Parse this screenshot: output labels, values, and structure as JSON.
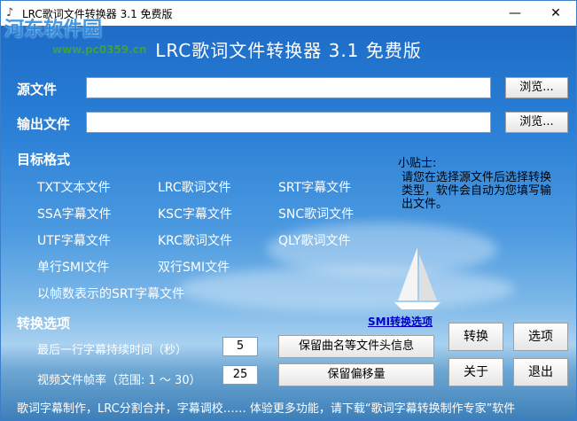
{
  "window": {
    "title": "LRC歌词文件转换器 3.1 免费版",
    "minimize_glyph": "—",
    "close_glyph": "✕"
  },
  "watermark": {
    "text": "河东软件园",
    "url": "www.pc0359.cn"
  },
  "banner": "LRC歌词文件转换器  3.1  免费版",
  "source": {
    "label": "源文件",
    "value": "",
    "browse": "浏览..."
  },
  "output": {
    "label": "输出文件",
    "value": "",
    "browse": "浏览..."
  },
  "target": {
    "label": "目标格式",
    "formats": [
      "TXT文本文件",
      "LRC歌词文件",
      "SRT字幕文件",
      "SSA字幕文件",
      "KSC字幕文件",
      "SNC歌词文件",
      "UTF字幕文件",
      "KRC歌词文件",
      "QLY歌词文件",
      "单行SMI文件",
      "双行SMI文件",
      "以帧数表示的SRT字幕文件"
    ]
  },
  "tip": {
    "title": "小贴士:",
    "body": "请您在选择源文件后选择转换类型，软件会自动为您填写输出文件。"
  },
  "options": {
    "label": "转换选项",
    "smi_link": "SMI转换选项",
    "last_line_label": "最后一行字幕持续时间（秒）",
    "last_line_value": "5",
    "framerate_label": "视频文件帧率（范围: 1 ～ 30）",
    "framerate_value": "25",
    "keep_header": "保留曲名等文件头信息",
    "keep_offset": "保留偏移量"
  },
  "actions": {
    "convert": "转换",
    "options": "选项",
    "about": "关于",
    "exit": "退出"
  },
  "footer": "歌词字幕制作，LRC分割合并，字幕调校……  体验更多功能，请下载“歌词字幕转换制作专家”软件"
}
